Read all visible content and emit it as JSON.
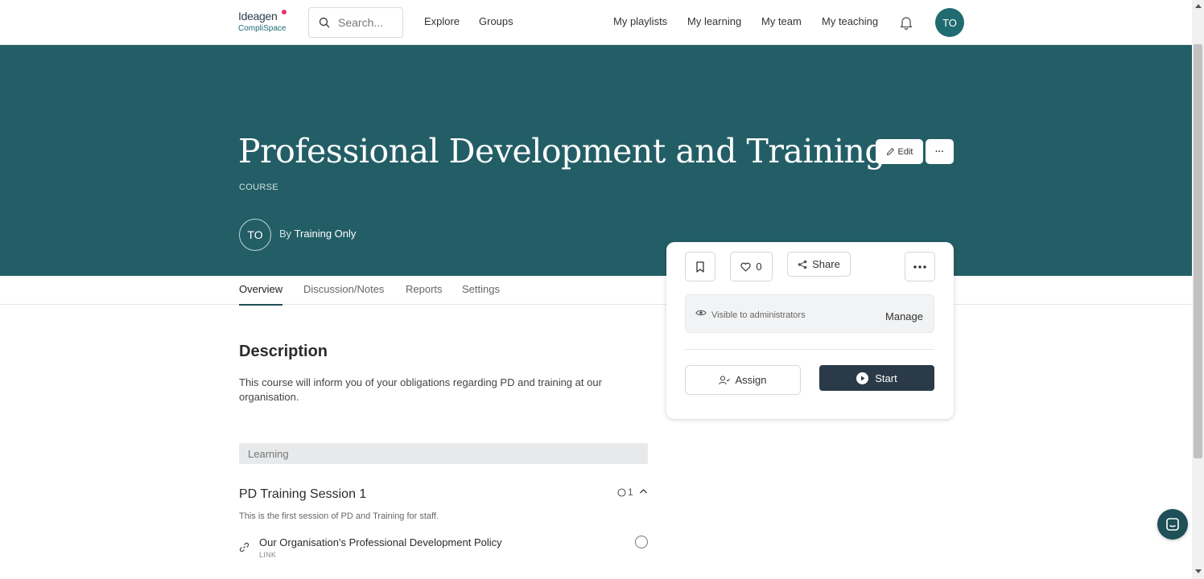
{
  "brand": {
    "logo_line1": "Ideagen",
    "logo_line2": "CompliSpace"
  },
  "search": {
    "placeholder": "Search..."
  },
  "nav": {
    "explore": "Explore",
    "groups": "Groups",
    "my_playlists": "My playlists",
    "my_learning": "My learning",
    "my_team": "My team",
    "my_teaching": "My teaching",
    "user_initials": "TO"
  },
  "hero": {
    "title": "Professional Development and Training",
    "type": "COURSE",
    "author_initials": "TO",
    "by_label": "By",
    "author": "Training Only",
    "edit_label": "Edit",
    "more_label": "···",
    "bg_color": "#235e66"
  },
  "tabs": [
    "Overview",
    "Discussion/Notes",
    "Reports",
    "Settings"
  ],
  "card": {
    "like_count": "0",
    "share_label": "Share",
    "visibility": "Visible to administrators",
    "manage_label": "Manage",
    "assign_label": "Assign",
    "start_label": "Start"
  },
  "content": {
    "description_heading": "Description",
    "description": "This course will inform you of your obligations regarding PD and training at our organisation.",
    "learning_label": "Learning",
    "session": {
      "title": "PD Training Session 1",
      "count": "1",
      "description": "This is the first session of PD and Training for staff.",
      "items": [
        {
          "title": "Our Organisation's Professional Development Policy",
          "type": "LINK"
        }
      ]
    }
  }
}
